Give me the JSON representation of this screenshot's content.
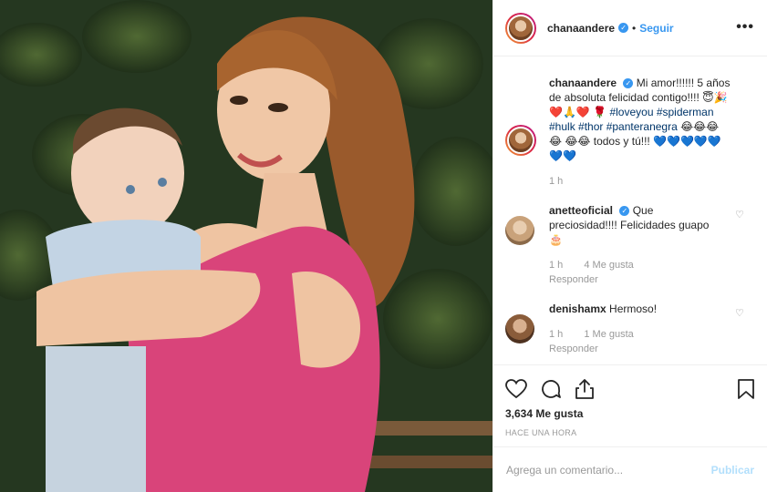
{
  "post": {
    "username": "chanaandere",
    "follow_label": "Seguir",
    "separator": "•",
    "more_label": "•••",
    "caption_text": "Mi amor!!!!!! 5 años de absoluta felicidad contigo!!!! 😇🎉❤️🙏❤️ 🌹",
    "hashtags": "#loveyou #spiderman #hulk #thor #panteranegra",
    "caption_tail": "😂😂😂😂 😂😂 todos y tú!!! 💙💙💙💙💙 💙💙",
    "caption_time": "1 h"
  },
  "comments": [
    {
      "username": "anetteoficial",
      "verified": true,
      "text": "Que preciosidad!!!! Felicidades guapo 🎂",
      "time": "1 h",
      "likes": "4 Me gusta",
      "reply": "Responder"
    },
    {
      "username": "denishamx",
      "verified": false,
      "text": "Hermoso!",
      "time": "1 h",
      "likes": "1 Me gusta",
      "reply": "Responder"
    }
  ],
  "actions": {
    "likes_count": "3,634 Me gusta",
    "timestamp": "HACE UNA HORA"
  },
  "composer": {
    "placeholder": "Agrega un comentario...",
    "publish_label": "Publicar"
  },
  "colors": {
    "link": "#3897f0",
    "hashtag": "#003569",
    "muted": "#999999"
  },
  "icons": [
    "verified-icon",
    "more-icon",
    "heart-icon",
    "comment-icon",
    "share-icon",
    "bookmark-icon"
  ]
}
